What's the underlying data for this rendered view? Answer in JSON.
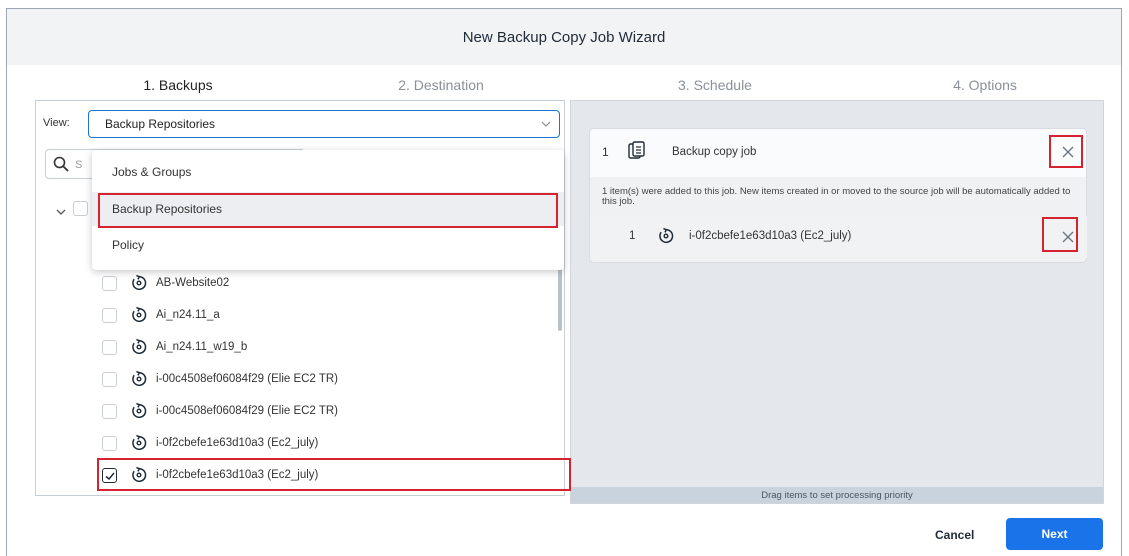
{
  "window": {
    "title": "New Backup Copy Job Wizard"
  },
  "steps": [
    {
      "label": "1. Backups"
    },
    {
      "label": "2. Destination"
    },
    {
      "label": "3. Schedule"
    },
    {
      "label": "4. Options"
    }
  ],
  "view": {
    "label": "View:",
    "selected": "Backup Repositories",
    "options": [
      "Jobs & Groups",
      "Backup Repositories",
      "Policy"
    ]
  },
  "search": {
    "placeholder": "S"
  },
  "inventory": {
    "items": [
      {
        "label": "AB-Website02",
        "checked": false
      },
      {
        "label": "Ai_n24.11_a",
        "checked": false
      },
      {
        "label": "Ai_n24.11_w19_b",
        "checked": false
      },
      {
        "label": "i-00c4508ef06084f29 (Elie EC2 TR)",
        "checked": false
      },
      {
        "label": "i-00c4508ef06084f29 (Elie EC2 TR)",
        "checked": false
      },
      {
        "label": "i-0f2cbefe1e63d10a3 (Ec2_july)",
        "checked": false
      },
      {
        "label": "i-0f2cbefe1e63d10a3 (Ec2_july)",
        "checked": true
      }
    ]
  },
  "job_card": {
    "number": "1",
    "title": "Backup copy job",
    "note": "1 item(s) were added to this job. New items created in or moved to the source job will be automatically added to this job.",
    "item": {
      "number": "1",
      "label": "i-0f2cbefe1e63d10a3 (Ec2_july)"
    }
  },
  "drag_hint": "Drag items to set processing priority",
  "buttons": {
    "cancel": "Cancel",
    "next": "Next"
  },
  "colors": {
    "accent": "#1a73e8",
    "highlight": "#d6232f"
  }
}
